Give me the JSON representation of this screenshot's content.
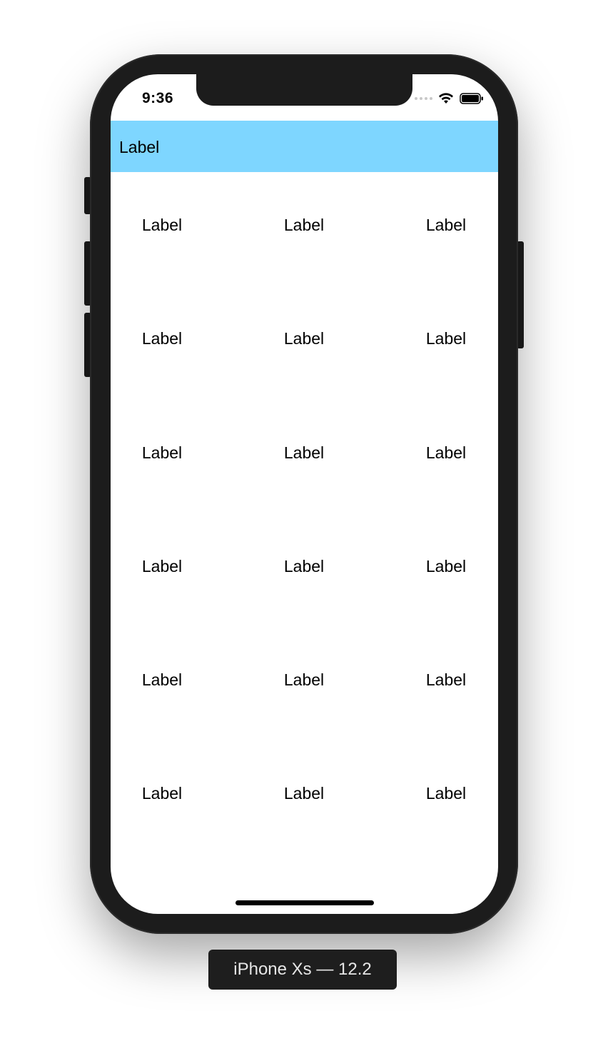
{
  "status_bar": {
    "time": "9:36"
  },
  "header": {
    "label": "Label",
    "color": "#7ed6ff"
  },
  "grid": {
    "rows": [
      [
        "Label",
        "Label",
        "Label"
      ],
      [
        "Label",
        "Label",
        "Label"
      ],
      [
        "Label",
        "Label",
        "Label"
      ],
      [
        "Label",
        "Label",
        "Label"
      ],
      [
        "Label",
        "Label",
        "Label"
      ],
      [
        "Label",
        "Label",
        "Label"
      ]
    ]
  },
  "device": {
    "caption": "iPhone Xs — 12.2"
  },
  "icons": [
    "signal-icon",
    "wifi-icon",
    "battery-icon"
  ]
}
